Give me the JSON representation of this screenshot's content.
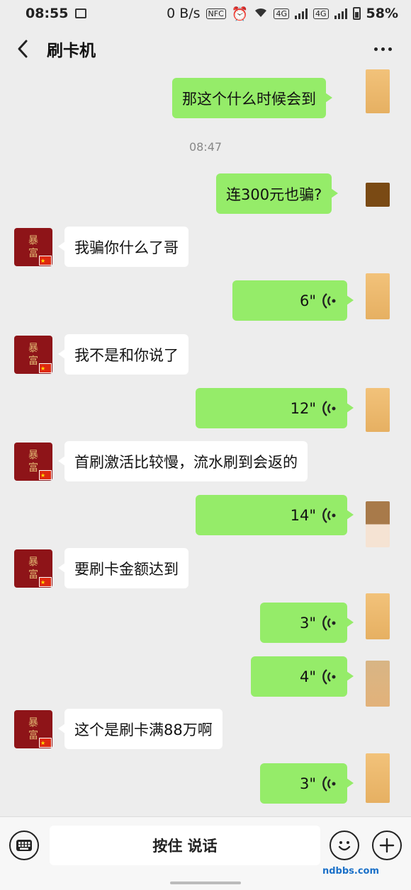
{
  "status_bar": {
    "time": "08:55",
    "speed": "0 B/s",
    "hd_badge": "NFC",
    "net1": "4G",
    "net2": "4G",
    "battery": "58%"
  },
  "header": {
    "title": "刷卡机",
    "back_icon": "chevron-left-icon",
    "more_icon": "more-dots-icon"
  },
  "chat": {
    "timestamp": "08:47",
    "messages": [
      {
        "side": "right",
        "type": "text",
        "text": "那这个什么时候会到"
      },
      {
        "side": "right",
        "type": "text",
        "text": "连300元也骗?"
      },
      {
        "side": "left",
        "type": "text",
        "text": "我骗你什么了哥"
      },
      {
        "side": "right",
        "type": "voice",
        "duration": "6\""
      },
      {
        "side": "left",
        "type": "text",
        "text": "我不是和你说了"
      },
      {
        "side": "right",
        "type": "voice",
        "duration": "12\""
      },
      {
        "side": "left",
        "type": "text",
        "text": "首刷激活比较慢，流水刷到会返的"
      },
      {
        "side": "right",
        "type": "voice",
        "duration": "14\""
      },
      {
        "side": "left",
        "type": "text",
        "text": "要刷卡金额达到"
      },
      {
        "side": "right",
        "type": "voice",
        "duration": "3\""
      },
      {
        "side": "right",
        "type": "voice",
        "duration": "4\""
      },
      {
        "side": "left",
        "type": "text",
        "text": "这个是刷卡满88万啊"
      },
      {
        "side": "right",
        "type": "voice",
        "duration": "3\""
      }
    ],
    "left_avatar_text": [
      "暴",
      "富"
    ]
  },
  "bottom_bar": {
    "hold_to_talk": "按住 说话",
    "keyboard_icon": "keyboard-icon",
    "emoji_icon": "emoji-icon",
    "plus_icon": "plus-icon"
  },
  "watermark": "ndbbs.com",
  "colors": {
    "chat_bg": "#ededed",
    "right_bubble": "#95ec69",
    "left_bubble": "#ffffff",
    "avatar_red": "#8e1418"
  }
}
